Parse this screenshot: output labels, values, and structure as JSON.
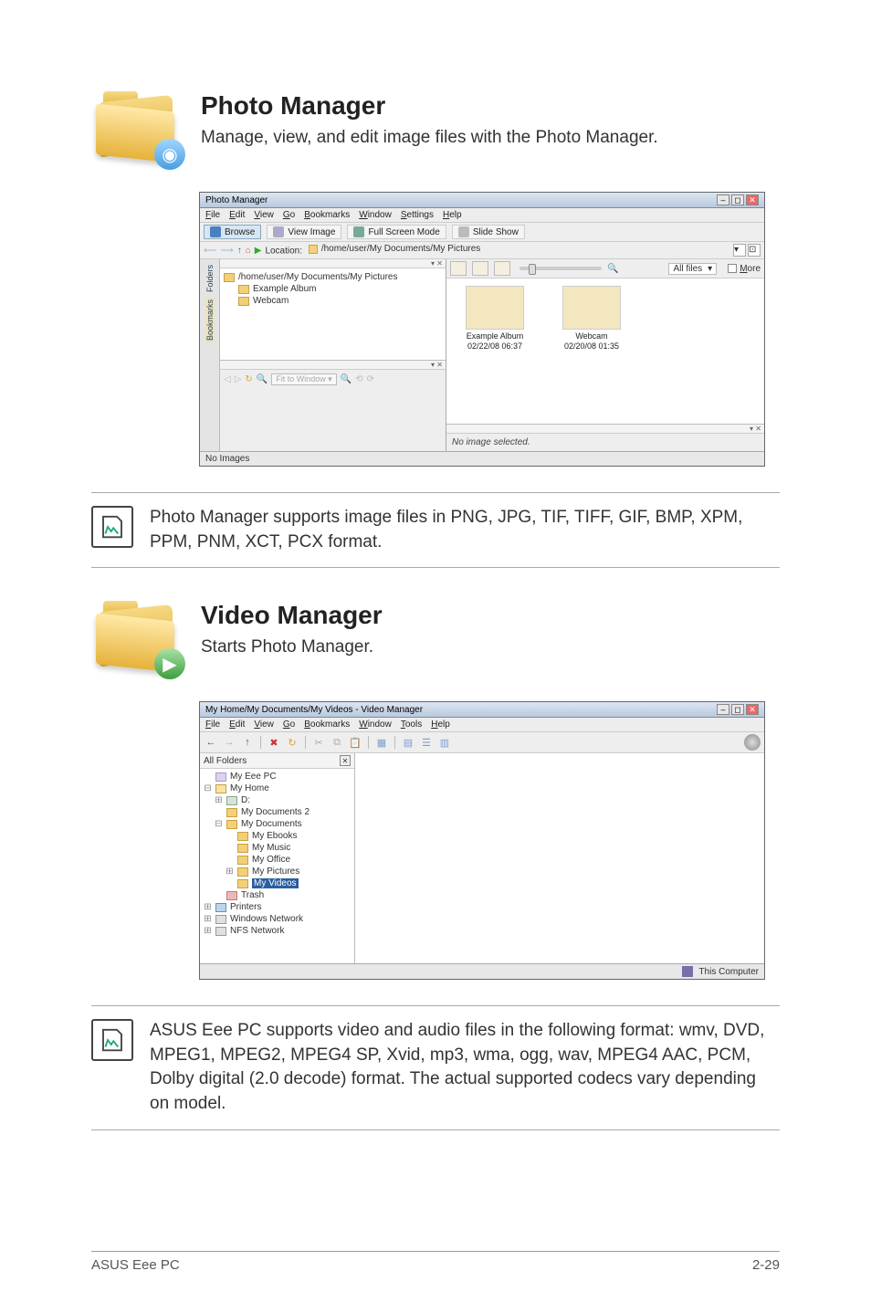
{
  "photo_manager": {
    "title": "Photo Manager",
    "desc": "Manage, view, and edit image files with the Photo Manager."
  },
  "pm_shot": {
    "window_title": "Photo Manager",
    "menus": [
      "File",
      "Edit",
      "View",
      "Go",
      "Bookmarks",
      "Window",
      "Settings",
      "Help"
    ],
    "mode_buttons": {
      "browse": "Browse",
      "view_image": "View Image",
      "full_screen": "Full Screen Mode",
      "slide_show": "Slide Show"
    },
    "location_label": "Location:",
    "location_path": "/home/user/My Documents/My Pictures",
    "side_tabs": {
      "folders": "Folders",
      "bookmarks": "Bookmarks"
    },
    "tree": {
      "root": "/home/user/My Documents/My Pictures",
      "children": [
        {
          "label": "Example Album"
        },
        {
          "label": "Webcam"
        }
      ]
    },
    "preview_fit": "Fit to Window",
    "filter_label": "All files",
    "more_label": "More",
    "thumbs": [
      {
        "name": "Example Album",
        "date": "02/22/08 06:37"
      },
      {
        "name": "Webcam",
        "date": "02/20/08 01:35"
      }
    ],
    "info_text": "No image selected.",
    "status_text": "No Images"
  },
  "pm_note": "Photo Manager supports image files in PNG, JPG, TIF, TIFF, GIF, BMP, XPM, PPM, PNM, XCT, PCX format.",
  "video_manager": {
    "title": "Video Manager",
    "desc": "Starts Photo Manager."
  },
  "vm_shot": {
    "window_title": "My Home/My Documents/My Videos - Video Manager",
    "menus": [
      "File",
      "Edit",
      "View",
      "Go",
      "Bookmarks",
      "Window",
      "Tools",
      "Help"
    ],
    "side_header": "All Folders",
    "tree": [
      {
        "d": 1,
        "exp": "",
        "icon": "pc",
        "label": "My Eee PC"
      },
      {
        "d": 1,
        "exp": "⊟",
        "icon": "home",
        "label": "My Home"
      },
      {
        "d": 2,
        "exp": "⊞",
        "icon": "drv",
        "label": "D:"
      },
      {
        "d": 2,
        "exp": "",
        "icon": "fi",
        "label": "My Documents 2"
      },
      {
        "d": 2,
        "exp": "⊟",
        "icon": "fi",
        "label": "My Documents"
      },
      {
        "d": 3,
        "exp": "",
        "icon": "fi",
        "label": "My Ebooks"
      },
      {
        "d": 3,
        "exp": "",
        "icon": "fi",
        "label": "My Music"
      },
      {
        "d": 3,
        "exp": "",
        "icon": "fi",
        "label": "My Office"
      },
      {
        "d": 3,
        "exp": "⊞",
        "icon": "fi",
        "label": "My Pictures"
      },
      {
        "d": 3,
        "exp": "",
        "icon": "fi",
        "label": "My Videos",
        "selected": true
      },
      {
        "d": 2,
        "exp": "",
        "icon": "red",
        "label": "Trash"
      },
      {
        "d": 1,
        "exp": "⊞",
        "icon": "blue",
        "label": "Printers"
      },
      {
        "d": 1,
        "exp": "⊞",
        "icon": "net",
        "label": "Windows Network"
      },
      {
        "d": 1,
        "exp": "⊞",
        "icon": "net",
        "label": "NFS Network"
      }
    ],
    "status": "This Computer"
  },
  "vm_note": "ASUS Eee PC supports video and audio files in the following format: wmv, DVD, MPEG1, MPEG2, MPEG4 SP, Xvid, mp3, wma, ogg, wav, MPEG4 AAC, PCM, Dolby digital (2.0 decode) format. The actual supported codecs vary depending on model.",
  "footer": {
    "left": "ASUS Eee PC",
    "right": "2-29"
  }
}
